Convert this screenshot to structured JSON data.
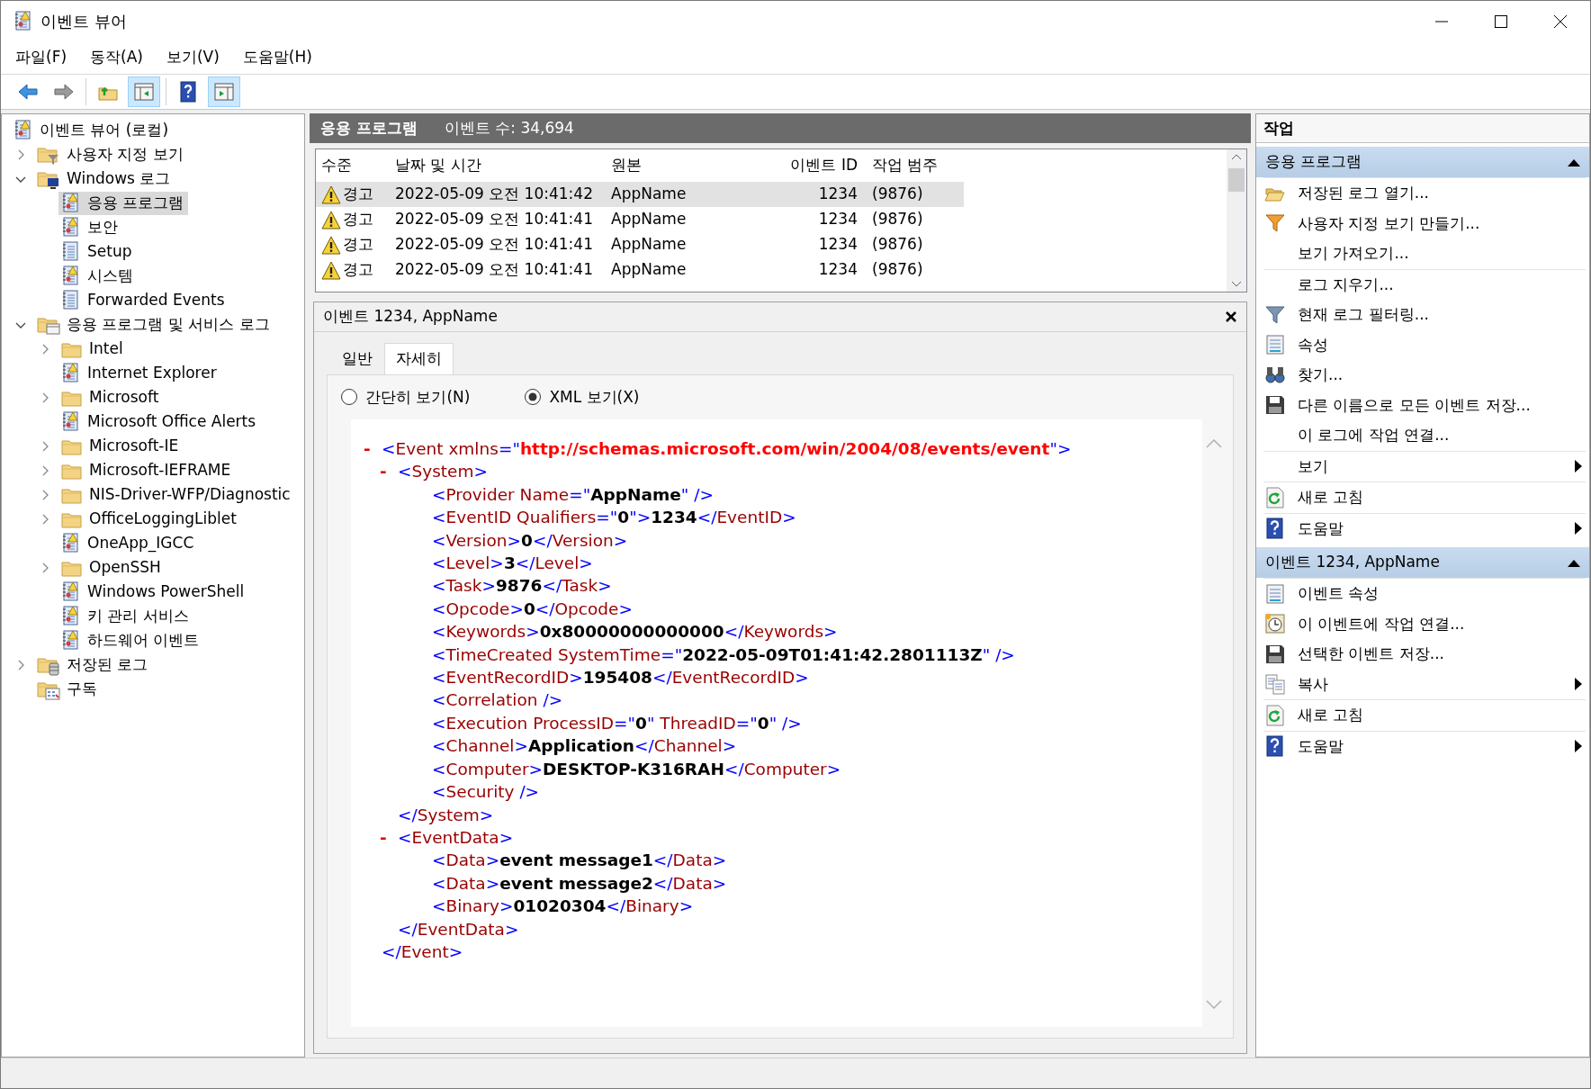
{
  "window": {
    "title": "이벤트 뷰어"
  },
  "menu": [
    {
      "label": "파일(F)"
    },
    {
      "label": "동작(A)"
    },
    {
      "label": "보기(V)"
    },
    {
      "label": "도움말(H)"
    }
  ],
  "toolbar": [
    [
      {
        "kind": "back"
      },
      {
        "kind": "forward"
      }
    ],
    [
      {
        "kind": "up"
      },
      {
        "kind": "show_tree",
        "on": true
      }
    ],
    [
      {
        "kind": "help"
      },
      {
        "kind": "show_actions",
        "on": true
      }
    ]
  ],
  "tree": [
    {
      "label": "이벤트 뷰어 (로컬)",
      "kind": "viewer",
      "selected": false,
      "children": [
        {
          "label": "사용자 지정 보기",
          "kind": "custom",
          "expanded": false,
          "selected": false
        },
        {
          "label": "Windows 로그",
          "kind": "windows",
          "expanded": true,
          "selected": false,
          "children": [
            {
              "label": "응용 프로그램",
              "kind": "log",
              "selected": true
            },
            {
              "label": "보안",
              "kind": "log",
              "selected": false
            },
            {
              "label": "Setup",
              "kind": "plain",
              "selected": false
            },
            {
              "label": "시스템",
              "kind": "log",
              "selected": false
            },
            {
              "label": "Forwarded Events",
              "kind": "plain",
              "selected": false
            }
          ]
        },
        {
          "label": "응용 프로그램 및 서비스 로그",
          "kind": "services",
          "expanded": true,
          "selected": false,
          "children": [
            {
              "label": "Intel",
              "kind": "folder",
              "expanded": false,
              "selected": false
            },
            {
              "label": "Internet Explorer",
              "kind": "log",
              "selected": false
            },
            {
              "label": "Microsoft",
              "kind": "folder",
              "expanded": false,
              "selected": false
            },
            {
              "label": "Microsoft Office Alerts",
              "kind": "log",
              "selected": false
            },
            {
              "label": "Microsoft-IE",
              "kind": "folder",
              "expanded": false,
              "selected": false
            },
            {
              "label": "Microsoft-IEFRAME",
              "kind": "folder",
              "expanded": false,
              "selected": false
            },
            {
              "label": "NIS-Driver-WFP/Diagnostic",
              "kind": "folder",
              "expanded": false,
              "selected": false
            },
            {
              "label": "OfficeLoggingLiblet",
              "kind": "folder",
              "expanded": false,
              "selected": false
            },
            {
              "label": "OneApp_IGCC",
              "kind": "log",
              "selected": false
            },
            {
              "label": "OpenSSH",
              "kind": "folder",
              "expanded": false,
              "selected": false
            },
            {
              "label": "Windows PowerShell",
              "kind": "log",
              "selected": false
            },
            {
              "label": "키 관리 서비스",
              "kind": "log",
              "selected": false
            },
            {
              "label": "하드웨어 이벤트",
              "kind": "log",
              "selected": false
            }
          ]
        },
        {
          "label": "저장된 로그",
          "kind": "saved",
          "expanded": false,
          "selected": false
        },
        {
          "label": "구독",
          "kind": "subscriptions",
          "selected": false
        }
      ]
    }
  ],
  "log_header": {
    "title": "응용 프로그램",
    "count": "이벤트 수: 34,694"
  },
  "events": {
    "columns": [
      "수준",
      "날짜 및 시간",
      "원본",
      "이벤트 ID",
      "작업 범주"
    ],
    "rows": [
      {
        "severity": "경고",
        "date": "2022-05-09 오전 10:41:42",
        "source": "AppName",
        "event_id": "1234",
        "category": "(9876)",
        "selected": true
      },
      {
        "severity": "경고",
        "date": "2022-05-09 오전 10:41:41",
        "source": "AppName",
        "event_id": "1234",
        "category": "(9876)",
        "selected": false
      },
      {
        "severity": "경고",
        "date": "2022-05-09 오전 10:41:41",
        "source": "AppName",
        "event_id": "1234",
        "category": "(9876)",
        "selected": false
      },
      {
        "severity": "경고",
        "date": "2022-05-09 오전 10:41:41",
        "source": "AppName",
        "event_id": "1234",
        "category": "(9876)",
        "selected": false
      }
    ]
  },
  "detail": {
    "title": "이벤트 1234, AppName",
    "tabs": [
      {
        "label": "일반",
        "selected": false
      },
      {
        "label": "자세히",
        "selected": true
      }
    ],
    "views": [
      {
        "label": "간단히 보기(N)",
        "selected": false
      },
      {
        "label": "XML 보기(X)",
        "selected": true
      }
    ],
    "xml": {
      "open": "<Event xmlns=\"**http://schemas.microsoft.com/win/2004/08/events/event**\">",
      "toggle": "-",
      "kind": "namespace",
      "close": "</Event>",
      "children": [
        {
          "open": "<System>",
          "toggle": "-",
          "close": "</System>",
          "children": [
            {
              "open": "<Provider Name=\"**AppName**\" />"
            },
            {
              "open": "<EventID Qualifiers=\"**0**\">**1234**</EventID>"
            },
            {
              "open": "<Version>**0**</Version>"
            },
            {
              "open": "<Level>**3**</Level>"
            },
            {
              "open": "<Task>**9876**</Task>"
            },
            {
              "open": "<Opcode>**0**</Opcode>"
            },
            {
              "open": "<Keywords>**0x80000000000000**</Keywords>"
            },
            {
              "open": "<TimeCreated SystemTime=\"**2022-05-09T01:41:42.2801113Z**\" />"
            },
            {
              "open": "<EventRecordID>**195408**</EventRecordID>"
            },
            {
              "open": "<Correlation />"
            },
            {
              "open": "<Execution ProcessID=\"**0**\" ThreadID=\"**0**\" />"
            },
            {
              "open": "<Channel>**Application**</Channel>"
            },
            {
              "open": "<Computer>**DESKTOP-K316RAH**</Computer>"
            },
            {
              "open": "<Security />"
            }
          ]
        },
        {
          "open": "<EventData>",
          "toggle": "-",
          "close": "</EventData>",
          "children": [
            {
              "open": "<Data>**event message1**</Data>"
            },
            {
              "open": "<Data>**event message2**</Data>"
            },
            {
              "open": "<Binary>**01020304**</Binary>"
            }
          ]
        }
      ]
    }
  },
  "actions": {
    "title": "작업",
    "sections": [
      {
        "title": "응용 프로그램",
        "expanded": true,
        "groups": [
          [
            {
              "label": "저장된 로그 열기...",
              "kind": "open",
              "submenu": false
            },
            {
              "label": "사용자 지정 보기 만들기...",
              "kind": "funnel",
              "submenu": false
            },
            {
              "label": "보기 가져오기...",
              "kind": "none",
              "submenu": false
            }
          ],
          [
            {
              "label": "로그 지우기...",
              "kind": "none",
              "submenu": false
            },
            {
              "label": "현재 로그 필터링...",
              "kind": "filter",
              "submenu": false
            },
            {
              "label": "속성",
              "kind": "properties",
              "submenu": false
            },
            {
              "label": "찾기...",
              "kind": "find",
              "submenu": false
            },
            {
              "label": "다른 이름으로 모든 이벤트 저장...",
              "kind": "save",
              "submenu": false
            },
            {
              "label": "이 로그에 작업 연결...",
              "kind": "none",
              "submenu": false
            }
          ],
          [
            {
              "label": "보기",
              "kind": "none",
              "submenu": true
            }
          ],
          [
            {
              "label": "새로 고침",
              "kind": "refresh",
              "submenu": false
            }
          ],
          [
            {
              "label": "도움말",
              "kind": "help",
              "submenu": true
            }
          ]
        ]
      },
      {
        "title": "이벤트 1234, AppName",
        "expanded": true,
        "groups": [
          [
            {
              "label": "이벤트 속성",
              "kind": "properties",
              "submenu": false
            },
            {
              "label": "이 이벤트에 작업 연결...",
              "kind": "task",
              "submenu": false
            },
            {
              "label": "선택한 이벤트 저장...",
              "kind": "save",
              "submenu": false
            },
            {
              "label": "복사",
              "kind": "copy",
              "submenu": true
            }
          ],
          [
            {
              "label": "새로 고침",
              "kind": "refresh",
              "submenu": false
            }
          ],
          [
            {
              "label": "도움말",
              "kind": "help",
              "submenu": true
            }
          ]
        ]
      }
    ]
  }
}
